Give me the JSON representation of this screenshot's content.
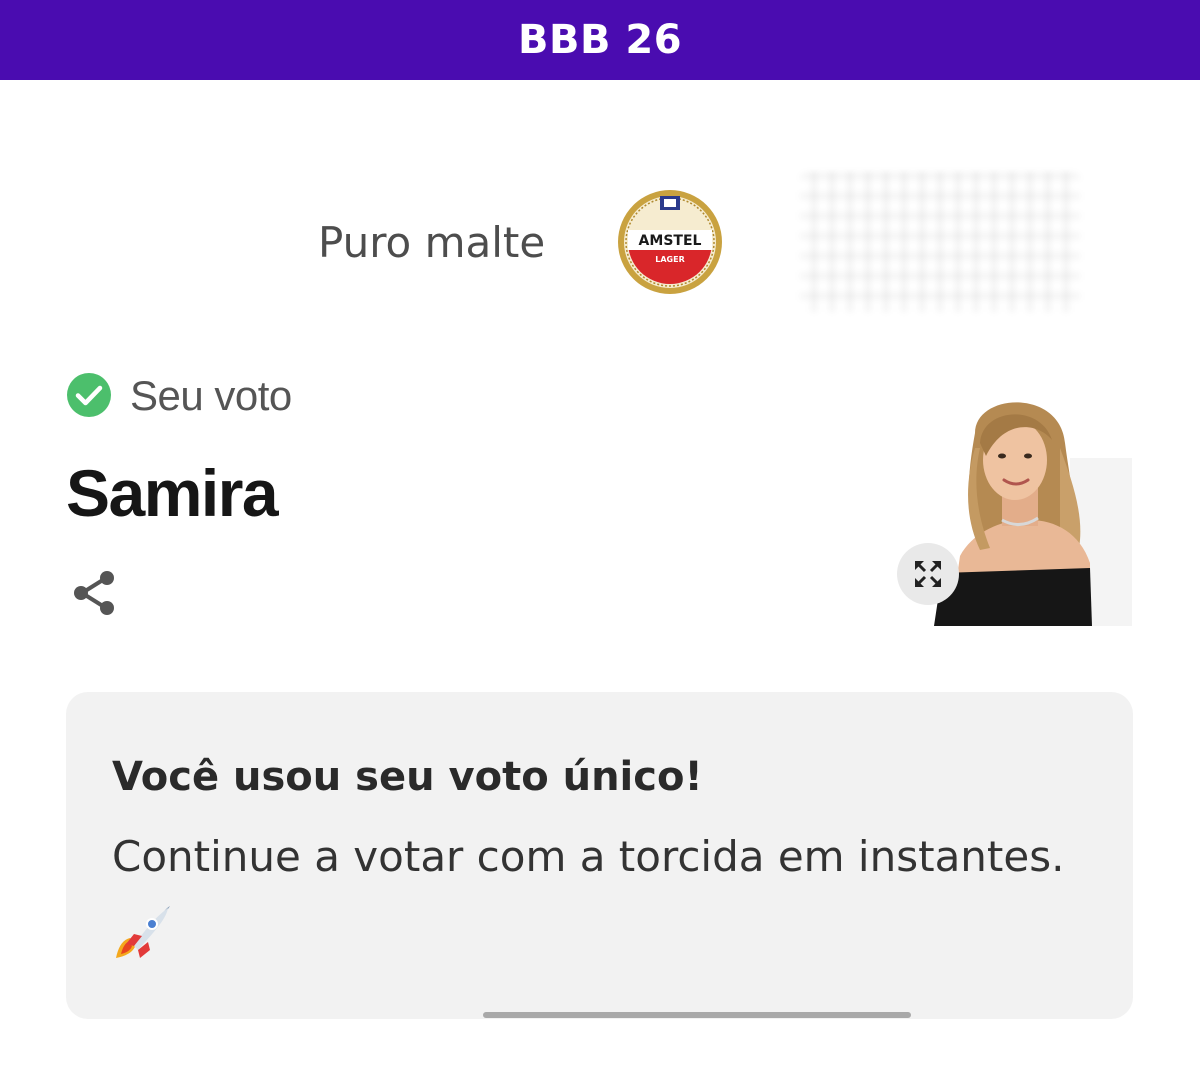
{
  "header": {
    "title": "BBB 26"
  },
  "sponsor": {
    "text": "Puro malte",
    "logo_icon": "amstel-lager-logo",
    "logo_text": "AMSTEL",
    "logo_subtext": "LAGER"
  },
  "vote": {
    "status_icon": "check-circle-icon",
    "label": "Seu voto",
    "candidate": "Samira"
  },
  "photo": {
    "expand_icon": "expand-icon"
  },
  "card": {
    "title": "Você usou seu voto único!",
    "body": "Continue a votar com a torcida em instantes.",
    "emoji_icon": "rocket-icon"
  },
  "colors": {
    "brand": "#4a0cb0",
    "success": "#4cbf6c",
    "card_bg": "#f2f2f2"
  }
}
